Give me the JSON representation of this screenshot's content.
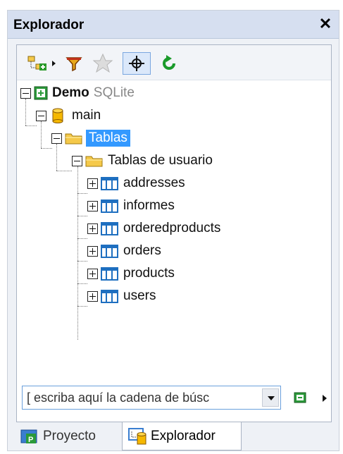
{
  "panel": {
    "title": "Explorador",
    "close_glyph": "✕"
  },
  "toolbar": {
    "buttons": [
      {
        "name": "add-connection-icon",
        "state": "normal"
      },
      {
        "name": "filter-icon",
        "state": "normal"
      },
      {
        "name": "favorites-star-icon",
        "state": "disabled"
      },
      {
        "name": "locate-crosshair-icon",
        "state": "active"
      },
      {
        "name": "refresh-icon",
        "state": "normal"
      }
    ]
  },
  "tree": {
    "root": {
      "label": "Demo",
      "sublabel": "SQLite",
      "icon": "database-connection-icon"
    },
    "schema": {
      "label": "main",
      "icon": "schema-cylinder-icon"
    },
    "tables_folder": {
      "label": "Tablas",
      "icon": "folder-icon",
      "selected": true
    },
    "user_tables_folder": {
      "label": "Tablas de usuario",
      "icon": "folder-icon"
    },
    "tables": [
      {
        "label": "addresses"
      },
      {
        "label": "informes"
      },
      {
        "label": "orderedproducts"
      },
      {
        "label": "orders"
      },
      {
        "label": "products"
      },
      {
        "label": "users"
      }
    ]
  },
  "search": {
    "placeholder": "[ escriba aquí la cadena de búsc"
  },
  "tabs": [
    {
      "label": "Proyecto",
      "icon": "project-icon",
      "active": false
    },
    {
      "label": "Explorador",
      "icon": "explorer-icon",
      "active": true
    }
  ],
  "colors": {
    "selection": "#3399ff",
    "folder": "#f5c94a",
    "table_icon": "#1e6fc0",
    "refresh": "#1a9a2a"
  }
}
